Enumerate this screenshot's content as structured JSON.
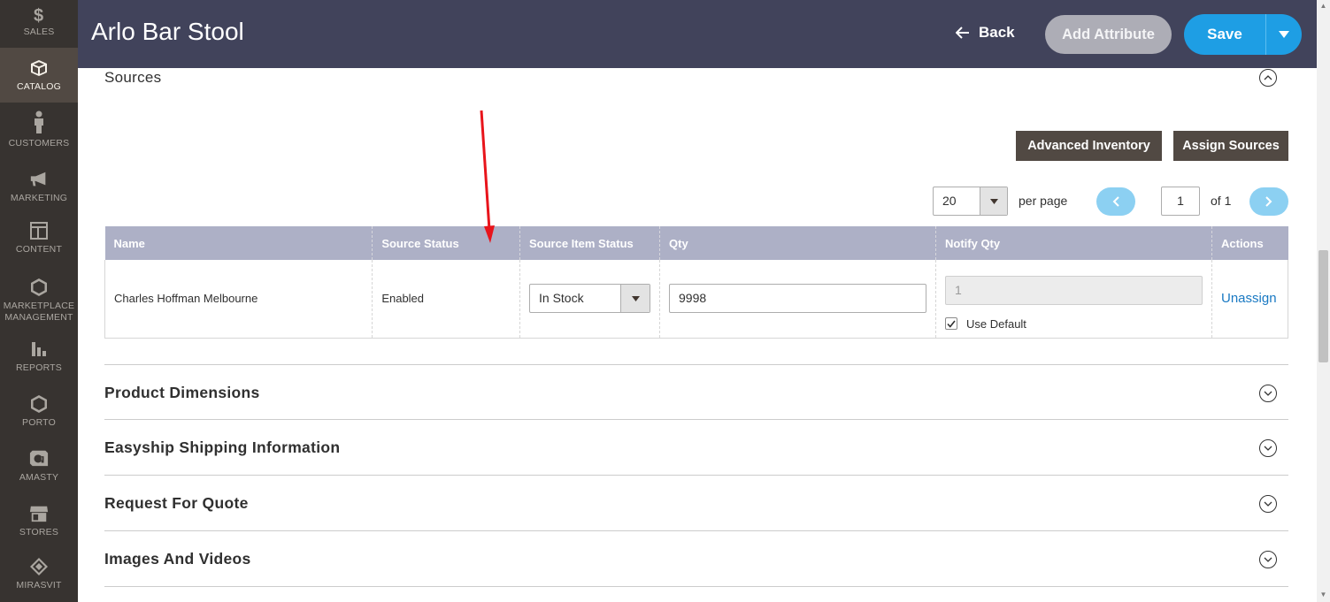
{
  "sidebar": {
    "items": [
      {
        "label": "SALES",
        "icon": "dollar-icon"
      },
      {
        "label": "CATALOG",
        "icon": "box-icon",
        "active": true
      },
      {
        "label": "CUSTOMERS",
        "icon": "person-icon"
      },
      {
        "label": "MARKETING",
        "icon": "megaphone-icon"
      },
      {
        "label": "CONTENT",
        "icon": "layout-icon"
      },
      {
        "label_line1": "MARKETPLACE",
        "label_line2": "MANAGEMENT",
        "icon": "hexagon-icon"
      },
      {
        "label": "REPORTS",
        "icon": "bar-chart-icon"
      },
      {
        "label": "PORTO",
        "icon": "hexagon-icon"
      },
      {
        "label": "AMASTY",
        "icon": "amasty-icon"
      },
      {
        "label": "STORES",
        "icon": "store-icon"
      },
      {
        "label": "MIRASVIT",
        "icon": "mirasvit-icon"
      }
    ]
  },
  "header": {
    "title": "Arlo Bar Stool",
    "back_label": "Back",
    "add_attribute_label": "Add Attribute",
    "save_label": "Save"
  },
  "sources": {
    "title": "Sources",
    "advanced_inventory_label": "Advanced Inventory",
    "assign_sources_label": "Assign Sources",
    "per_page_value": "20",
    "per_page_label": "per page",
    "current_page": "1",
    "page_of": "of 1",
    "table": {
      "columns": [
        "Name",
        "Source Status",
        "Source Item Status",
        "Qty",
        "Notify Qty",
        "Actions"
      ],
      "rows": [
        {
          "name": "Charles Hoffman Melbourne",
          "source_status": "Enabled",
          "source_item_status": "In Stock",
          "qty": "9998",
          "notify_qty": "1",
          "use_default_label": "Use Default",
          "use_default_checked": true,
          "action": "Unassign"
        }
      ]
    }
  },
  "sections": [
    {
      "title": "Product Dimensions"
    },
    {
      "title": "Easyship Shipping Information"
    },
    {
      "title": "Request For Quote"
    },
    {
      "title": "Images And Videos"
    }
  ],
  "colors": {
    "sidebar_bg": "#373330",
    "header_bg": "#41435b",
    "save_button": "#1e9ee4",
    "table_header": "#adb0c6",
    "link": "#1979c3",
    "annotation_arrow": "#e8141b"
  }
}
